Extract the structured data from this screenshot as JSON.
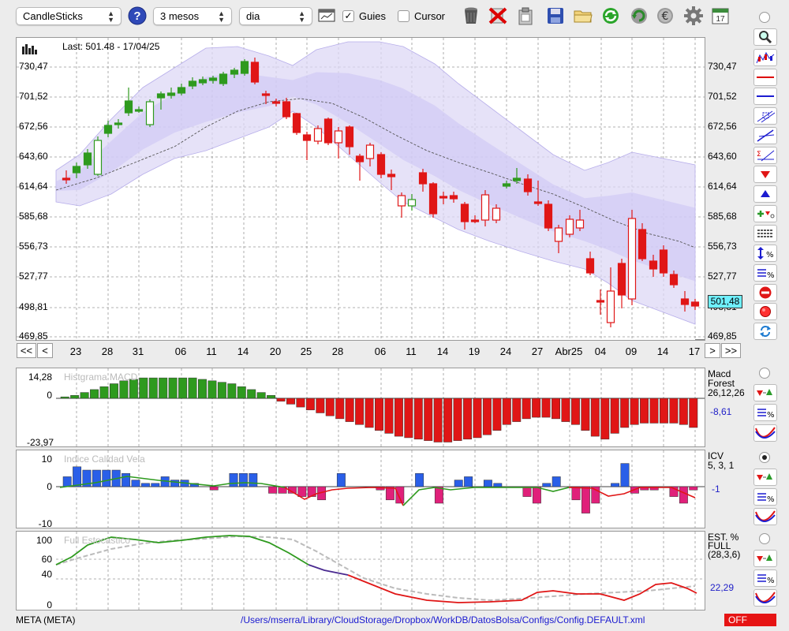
{
  "toolbar": {
    "chart_type": "CandleSticks",
    "period": "3 mesos",
    "interval": "dia",
    "guides_label": "Guies",
    "guides_checked": true,
    "cursor_label": "Cursor",
    "cursor_checked": false,
    "help_glyph": "?",
    "calendar_day": "17"
  },
  "main_chart": {
    "last_label": "Last: 501.48 - 17/04/25",
    "price_ticks": [
      "730,47",
      "701,52",
      "672,56",
      "643,60",
      "614,64",
      "585,68",
      "556,73",
      "527,77",
      "498,81",
      "469,85"
    ],
    "current_price": "501,48",
    "date_labels": [
      "23",
      "28",
      "31",
      "06",
      "11",
      "14",
      "20",
      "25",
      "28",
      "06",
      "11",
      "14",
      "19",
      "24",
      "27",
      "Abr25",
      "04",
      "09",
      "14",
      "17"
    ],
    "nav": {
      "first": "<<",
      "prev": "<",
      "next": ">",
      "last": ">>"
    },
    "colors": {
      "up": "#2e9a1e",
      "down": "#e01616",
      "band": "#ddd8f6"
    }
  },
  "macd_panel": {
    "title": "Histgrama MACD",
    "name": "Macd",
    "name2": "Forest",
    "params": "26,12,26",
    "value": "-8,61",
    "ticks": [
      "14,28",
      "0",
      "-23,97"
    ]
  },
  "icv_panel": {
    "title": "Indice Calidad Vela",
    "name": "ICV",
    "params": "5, 3, 1",
    "value": "-1",
    "ticks": [
      "10",
      "0",
      "-10"
    ]
  },
  "stoch_panel": {
    "title": "Full Estocastico",
    "name": "EST. %",
    "name2": "FULL",
    "params": "(28,3,6)",
    "value": "22,29",
    "ticks": [
      "100",
      "60",
      "40",
      "0"
    ]
  },
  "status": {
    "ticker": "META (META)",
    "path": "/Users/mserra/Library/CloudStorage/Dropbox/WorkDB/DatosBolsa/Configs/Config.DEFAULT.xml",
    "state": "OFF"
  },
  "icons": [
    "help-icon",
    "monitor-icon",
    "trash-icon",
    "delete-icon",
    "clipboard-icon",
    "save-icon",
    "folder-icon",
    "refresh-icon",
    "reload-icon",
    "euro-icon",
    "gear-icon",
    "calendar-icon",
    "zoom-icon"
  ]
}
